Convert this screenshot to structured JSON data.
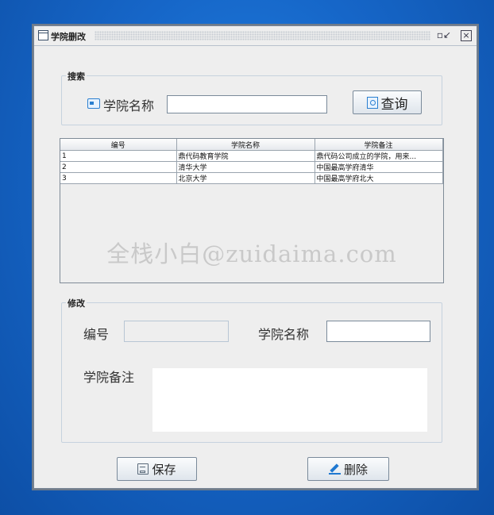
{
  "window": {
    "title": "学院删改"
  },
  "search": {
    "group_title": "搜索",
    "label": "学院名称",
    "input_value": "",
    "button_label": "查询"
  },
  "table": {
    "columns": [
      "编号",
      "学院名称",
      "学院备注"
    ],
    "rows": [
      [
        "1",
        "鼎代码教育学院",
        "鼎代码公司成立的学院，用来..."
      ],
      [
        "2",
        "清华大学",
        "中国最高学府清华"
      ],
      [
        "3",
        "北京大学",
        "中国最高学府北大"
      ]
    ],
    "watermark": "全栈小白@zuidaima.com"
  },
  "edit": {
    "group_title": "修改",
    "id_label": "编号",
    "id_value": "",
    "name_label": "学院名称",
    "name_value": "",
    "remark_label": "学院备注",
    "remark_value": ""
  },
  "actions": {
    "save_label": "保存",
    "delete_label": "删除"
  }
}
